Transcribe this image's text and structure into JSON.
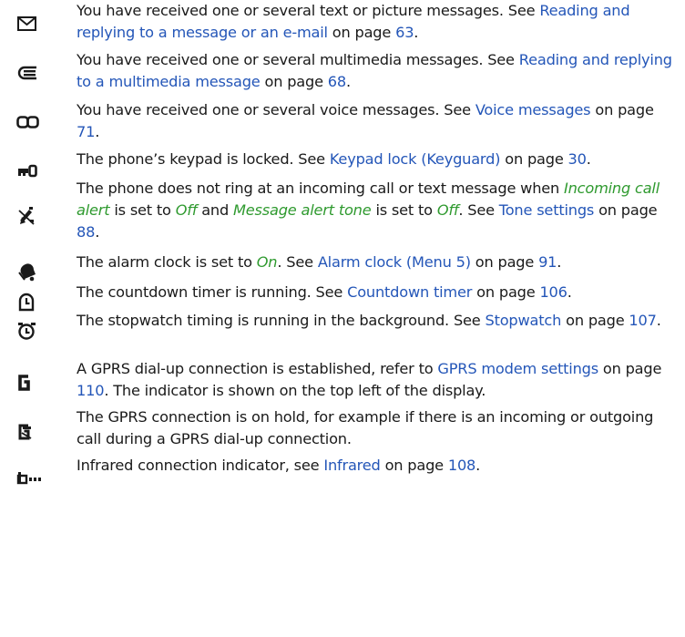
{
  "entries": [
    {
      "icon": "envelope-icon",
      "parts": [
        {
          "t": "You have received one or several text or picture messages. See "
        },
        {
          "t": "Reading and replying to a message or an e-mail",
          "k": "link"
        },
        {
          "t": " on page "
        },
        {
          "t": "63",
          "k": "link"
        },
        {
          "t": "."
        }
      ]
    },
    {
      "icon": "multimedia-message-icon",
      "parts": [
        {
          "t": "You have received one or several multimedia messages. See "
        },
        {
          "t": "Reading and replying to a multimedia message",
          "k": "link"
        },
        {
          "t": " on page "
        },
        {
          "t": "68",
          "k": "link"
        },
        {
          "t": "."
        }
      ]
    },
    {
      "icon": "voicemail-icon",
      "parts": [
        {
          "t": "You have received one or several voice messages. See "
        },
        {
          "t": "Voice messages",
          "k": "link"
        },
        {
          "t": " on page "
        },
        {
          "t": "71",
          "k": "link"
        },
        {
          "t": "."
        }
      ]
    },
    {
      "icon": "keypad-lock-icon",
      "parts": [
        {
          "t": "The phone’s keypad is locked. See "
        },
        {
          "t": "Keypad lock (Keyguard)",
          "k": "link"
        },
        {
          "t": " on page "
        },
        {
          "t": "30",
          "k": "link"
        },
        {
          "t": "."
        }
      ]
    },
    {
      "icon": "silent-mode-icon",
      "parts": [
        {
          "t": "The phone does not ring at an incoming call or text message when "
        },
        {
          "t": "Incoming call alert",
          "k": "em"
        },
        {
          "t": " is set to "
        },
        {
          "t": "Off",
          "k": "em"
        },
        {
          "t": " and "
        },
        {
          "t": "Message alert tone",
          "k": "em"
        },
        {
          "t": " is set to "
        },
        {
          "t": "Off",
          "k": "em"
        },
        {
          "t": ". See "
        },
        {
          "t": "Tone settings",
          "k": "link"
        },
        {
          "t": " on page "
        },
        {
          "t": "88",
          "k": "link"
        },
        {
          "t": "."
        }
      ]
    },
    {
      "icon": "alarm-bell-icon",
      "parts": [
        {
          "t": "The alarm clock is set to "
        },
        {
          "t": "On",
          "k": "em"
        },
        {
          "t": ". See "
        },
        {
          "t": "Alarm clock (Menu 5)",
          "k": "link"
        },
        {
          "t": " on page "
        },
        {
          "t": "91",
          "k": "link"
        },
        {
          "t": "."
        }
      ]
    },
    {
      "icon": "countdown-timer-icon",
      "parts": [
        {
          "t": "The countdown timer is running. See "
        },
        {
          "t": "Countdown timer",
          "k": "link"
        },
        {
          "t": " on page "
        },
        {
          "t": "106",
          "k": "link"
        },
        {
          "t": "."
        }
      ]
    },
    {
      "icon": "stopwatch-icon",
      "parts": [
        {
          "t": "The stopwatch timing is running in the background. See "
        },
        {
          "t": "Stopwatch",
          "k": "link"
        },
        {
          "t": " on page "
        },
        {
          "t": "107",
          "k": "link"
        },
        {
          "t": "."
        }
      ]
    },
    {
      "icon": "gprs-connected-icon",
      "parts": [
        {
          "t": "A GPRS dial-up connection is established, refer to "
        },
        {
          "t": "GPRS modem settings",
          "k": "link"
        },
        {
          "t": " on page "
        },
        {
          "t": "110",
          "k": "link"
        },
        {
          "t": ". The indicator is shown on the top left of the display."
        }
      ]
    },
    {
      "icon": "gprs-hold-icon",
      "parts": [
        {
          "t": "The GPRS connection is on hold, for example if there is an incoming or outgoing call during a GPRS dial-up connection."
        }
      ]
    },
    {
      "icon": "infrared-icon",
      "parts": [
        {
          "t": "Infrared connection indicator, see "
        },
        {
          "t": "Infrared",
          "k": "link"
        },
        {
          "t": " on page "
        },
        {
          "t": "108",
          "k": "link"
        },
        {
          "t": "."
        }
      ]
    }
  ]
}
